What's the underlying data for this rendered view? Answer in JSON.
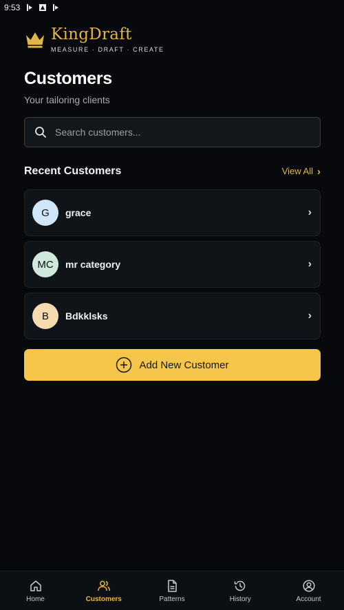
{
  "status_bar": {
    "time": "9:53"
  },
  "brand": {
    "name": "KingDraft",
    "tagline": "MEASURE · DRAFT · CREATE",
    "accent": "#e2b547"
  },
  "header": {
    "title": "Customers",
    "subtitle": "Your tailoring clients"
  },
  "search": {
    "placeholder": "Search customers...",
    "value": ""
  },
  "recent": {
    "title": "Recent Customers",
    "view_all_label": "View All",
    "customers": [
      {
        "initials": "G",
        "name": "grace",
        "avatar_color": "#cfe7f8"
      },
      {
        "initials": "MC",
        "name": "mr category",
        "avatar_color": "#cfeadc"
      },
      {
        "initials": "B",
        "name": "Bdkklsks",
        "avatar_color": "#f5dcb0"
      }
    ]
  },
  "add_button": {
    "label": "Add New Customer",
    "color": "#f6c64a"
  },
  "nav": {
    "items": [
      {
        "label": "Home",
        "icon": "home-icon"
      },
      {
        "label": "Customers",
        "icon": "users-icon",
        "active": true
      },
      {
        "label": "Patterns",
        "icon": "document-icon"
      },
      {
        "label": "History",
        "icon": "history-icon"
      },
      {
        "label": "Account",
        "icon": "user-circle-icon"
      }
    ]
  }
}
